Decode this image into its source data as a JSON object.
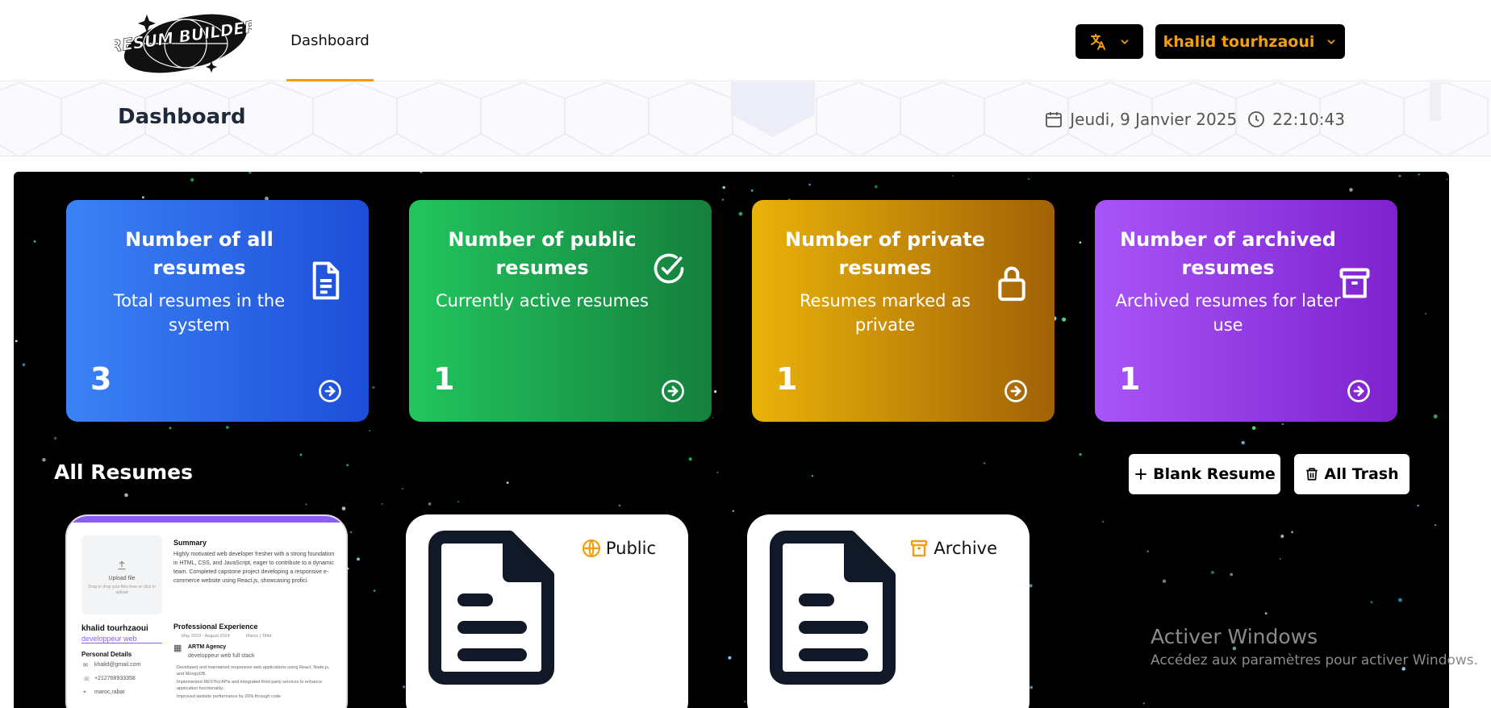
{
  "nav": {
    "logo_text": "RESUM BUILDER",
    "tab_dashboard": "Dashboard",
    "user_name": "khalid tourhzaoui"
  },
  "header": {
    "title": "Dashboard",
    "date": "Jeudi, 9 Janvier 2025",
    "time": "22:10:43"
  },
  "stats": [
    {
      "title": "Number of all resumes",
      "desc": "Total resumes in the system",
      "count": "3",
      "color_from": "#3b82f6",
      "color_to": "#1d4ed8",
      "icon": "document-icon"
    },
    {
      "title": "Number of public resumes",
      "desc": "Currently active resumes",
      "count": "1",
      "color_from": "#22c55e",
      "color_to": "#15803d",
      "icon": "check-circle-icon"
    },
    {
      "title": "Number of private resumes",
      "desc": "Resumes marked as private",
      "count": "1",
      "color_from": "#eab308",
      "color_to": "#a16207",
      "icon": "lock-icon"
    },
    {
      "title": "Number of archived resumes",
      "desc": "Archived resumes for later use",
      "count": "1",
      "color_from": "#a855f7",
      "color_to": "#7e22ce",
      "icon": "archive-icon"
    }
  ],
  "resumes": {
    "section_title": "All Resumes",
    "blank_label": "Blank Resume",
    "trash_label": "All Trash",
    "badge_public": "Public",
    "badge_archive": "Archive"
  },
  "preview": {
    "upload_title": "Upload file",
    "upload_hint": "Drag or drop your files here or click to upload",
    "name": "khalid tourhzaoui",
    "role": "developpeur web",
    "personal_details": "Personal Details",
    "email": "khalid@gmail.com",
    "phone": "+212768933358",
    "location": "maroc,rabat",
    "summary_title": "Summary",
    "summary_text": "Highly motivated web developer fresher with a strong foundation in HTML, CSS, and JavaScript, eager to contribute to a dynamic team. Completed capstone project developing a responsive e-commerce website using React.js, showcasing profici.",
    "exp_title": "Professional Experience",
    "exp_dates": "May 2023 - August 2024",
    "exp_location": "Maroc | Tiflet",
    "exp_company": "ARTM Agency",
    "exp_role": "developpeur web full stack",
    "exp_b1": "Developed and maintained responsive web applications using React, Node.js, and MongoDB.",
    "exp_b2": "Implemented RESTful APIs and integrated third-party services to enhance application functionality.",
    "exp_b3": "Improved website performance by 20% through code"
  },
  "watermark": {
    "line1": "Activer Windows",
    "line2": "Accédez aux paramètres pour activer Windows."
  }
}
